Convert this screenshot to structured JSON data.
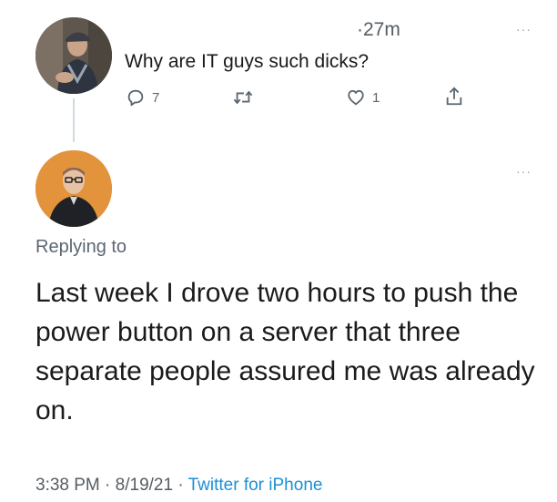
{
  "original_tweet": {
    "time_ago": "·27m",
    "more_label": "···",
    "text": "Why are IT guys such dicks?",
    "reply_count": "7",
    "like_count": "1",
    "icons": [
      "reply-icon",
      "retweet-icon",
      "like-icon",
      "share-icon"
    ]
  },
  "reply_tweet": {
    "more_label": "···",
    "replying_to_label": "Replying to",
    "text": "Last week I drove two hours to push the power button on a server that three separate people assured me was already on.",
    "footer": {
      "time": "3:38 PM",
      "separator_1": " · ",
      "date": "8/19/21",
      "separator_2": " · ",
      "source": "Twitter for iPhone"
    }
  },
  "colors": {
    "link": "#1d8fd6",
    "secondary_text": "#5b6670",
    "avatar_2_background": "#e2933b"
  }
}
